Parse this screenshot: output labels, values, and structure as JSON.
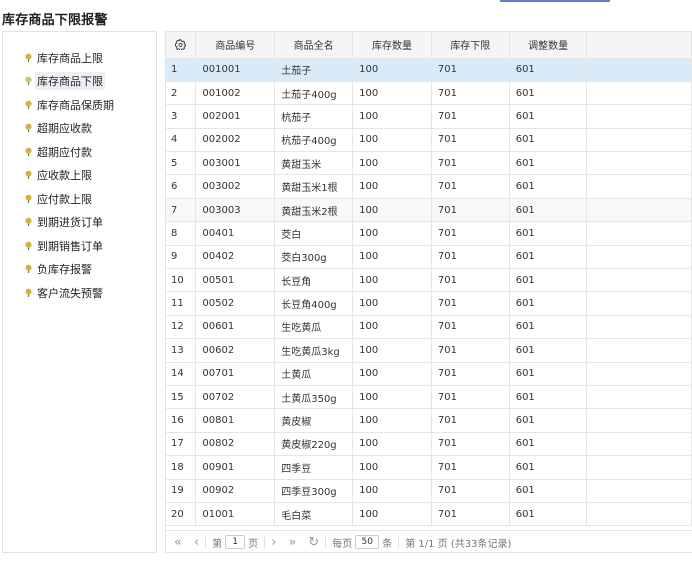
{
  "page": {
    "title": "库存商品下限报警"
  },
  "sidebar": {
    "items": [
      {
        "label": "库存商品上限",
        "active": false
      },
      {
        "label": "库存商品下限",
        "active": true
      },
      {
        "label": "库存商品保质期",
        "active": false
      },
      {
        "label": "超期应收款",
        "active": false
      },
      {
        "label": "超期应付款",
        "active": false
      },
      {
        "label": "应收款上限",
        "active": false
      },
      {
        "label": "应付款上限",
        "active": false
      },
      {
        "label": "到期进货订单",
        "active": false
      },
      {
        "label": "到期销售订单",
        "active": false
      },
      {
        "label": "负库存报警",
        "active": false
      },
      {
        "label": "客户流失预警",
        "active": false
      }
    ]
  },
  "table": {
    "columns": [
      "商品编号",
      "商品全名",
      "库存数量",
      "库存下限",
      "调整数量"
    ],
    "rows": [
      [
        "1",
        "001001",
        "土茄子",
        "100",
        "701",
        "601"
      ],
      [
        "2",
        "001002",
        "土茄子400g",
        "100",
        "701",
        "601"
      ],
      [
        "3",
        "002001",
        "杭茄子",
        "100",
        "701",
        "601"
      ],
      [
        "4",
        "002002",
        "杭茄子400g",
        "100",
        "701",
        "601"
      ],
      [
        "5",
        "003001",
        "黄甜玉米",
        "100",
        "701",
        "601"
      ],
      [
        "6",
        "003002",
        "黄甜玉米1根",
        "100",
        "701",
        "601"
      ],
      [
        "7",
        "003003",
        "黄甜玉米2根",
        "100",
        "701",
        "601"
      ],
      [
        "8",
        "00401",
        "茭白",
        "100",
        "701",
        "601"
      ],
      [
        "9",
        "00402",
        "茭白300g",
        "100",
        "701",
        "601"
      ],
      [
        "10",
        "00501",
        "长豆角",
        "100",
        "701",
        "601"
      ],
      [
        "11",
        "00502",
        "长豆角400g",
        "100",
        "701",
        "601"
      ],
      [
        "12",
        "00601",
        "生吃黄瓜",
        "100",
        "701",
        "601"
      ],
      [
        "13",
        "00602",
        "生吃黄瓜3kg",
        "100",
        "701",
        "601"
      ],
      [
        "14",
        "00701",
        "土黄瓜",
        "100",
        "701",
        "601"
      ],
      [
        "15",
        "00702",
        "土黄瓜350g",
        "100",
        "701",
        "601"
      ],
      [
        "16",
        "00801",
        "黄皮椒",
        "100",
        "701",
        "601"
      ],
      [
        "17",
        "00802",
        "黄皮椒220g",
        "100",
        "701",
        "601"
      ],
      [
        "18",
        "00901",
        "四季豆",
        "100",
        "701",
        "601"
      ],
      [
        "19",
        "00902",
        "四季豆300g",
        "100",
        "701",
        "601"
      ],
      [
        "20",
        "01001",
        "毛白菜",
        "100",
        "701",
        "601"
      ]
    ],
    "selected_row": 0
  },
  "pager": {
    "first_icon": "«",
    "prev_icon": "‹",
    "page_prefix": "第",
    "page_value": "1",
    "page_suffix": "页",
    "next_icon": "›",
    "last_icon": "»",
    "refresh_icon": "↻",
    "per_page_prefix": "每页",
    "per_page_value": "50",
    "per_page_suffix": "条",
    "summary": "第 1/1 页 (共33条记录)"
  },
  "icons": {
    "leaf_color": "#d7b048",
    "leaf_stem_color": "#2f9e44",
    "settings": "gear-icon"
  }
}
